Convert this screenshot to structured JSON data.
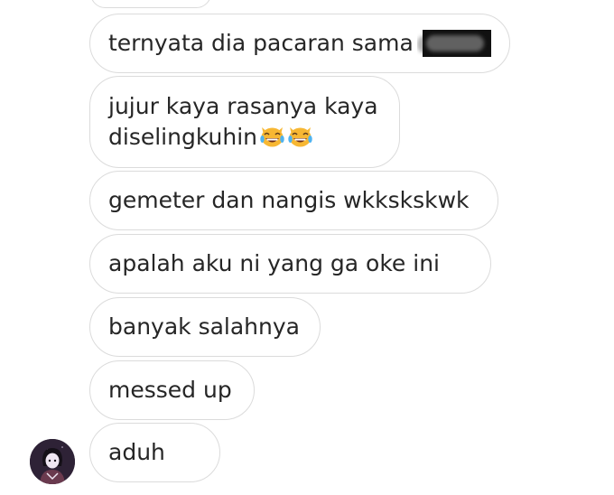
{
  "conversation": {
    "messages": [
      {
        "text": "ternyata dia pacaran sama",
        "redacted": true
      },
      {
        "lines": [
          "jujur kaya rasanya kaya",
          "diselingkuhin"
        ],
        "emoji": [
          "crying-laughing-cat-emoji",
          "crying-laughing-cat-emoji"
        ]
      },
      {
        "text": "gemeter dan nangis wkkskskwk"
      },
      {
        "text": "apalah aku ni yang ga oke ini"
      },
      {
        "text": "banyak salahnya"
      },
      {
        "text": "messed up"
      },
      {
        "text": "aduh"
      }
    ],
    "sender": {
      "avatar_icon": "user-avatar"
    }
  },
  "colors": {
    "bubble_border": "#dbdbdb",
    "text": "#262626",
    "background": "#ffffff",
    "emoji_face": "#f7b733",
    "redaction": "#111111"
  }
}
